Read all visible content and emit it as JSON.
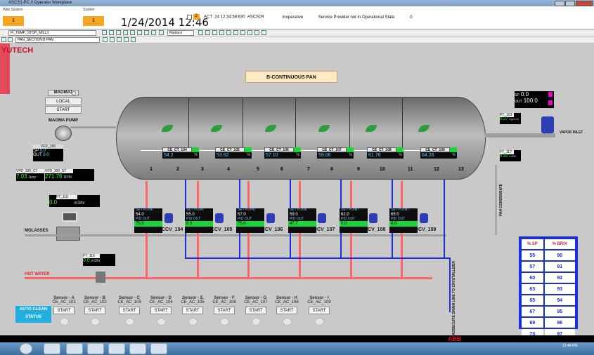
{
  "window": {
    "title": "ASCS1-PC // Operator Workplace"
  },
  "header": {
    "web_system_label": "Web System",
    "web_system_count": "1",
    "system_label": "System",
    "system_count": "1",
    "datetime": "1/24/2014 12:46",
    "alarm": {
      "count": "2",
      "state": "ACT",
      "time": "24 12:34:58:630",
      "source": "ASCS1R",
      "status": "Inoperative",
      "message": "Service Provider not in Operational State",
      "value": "0"
    }
  },
  "toolbar": {
    "object_combo": "FI_TEMP_STOP_MILL3",
    "replace_label": "Replace",
    "section_combo": "PAN_SECTION:B PAN"
  },
  "brand": "YUTECH",
  "title": "B-CONTINUOUS PAN",
  "magma": {
    "name": "MAGMA1",
    "local": "LOCAL",
    "start": "START",
    "pump_label": "MAGMA PUMP"
  },
  "vfd100": {
    "tag": "VFD_100",
    "sp_label": "SP",
    "sp": "0.0",
    "out_label": "OUT",
    "out": "0.0"
  },
  "vfd_ct": {
    "tag": "VFD_100_CT",
    "value": "7.03",
    "unit": "Amp"
  },
  "vfd_st": {
    "tag": "VFD_100_ST",
    "value": "271.76",
    "unit": "RPM"
  },
  "ft115": {
    "tag": "FT_115",
    "value": "0.0",
    "unit": "m3/hr"
  },
  "ft116": {
    "tag": "FT_116",
    "value": "0.0",
    "unit": "m3/hr"
  },
  "ft101": {
    "tag": "PT_101",
    "value": "0.27",
    "unit": "Kg/cm2"
  },
  "ft117": {
    "tag": "FT_117",
    "value": "0.22",
    "unit": "m3/hr"
  },
  "vapor": {
    "sp_label": "SP",
    "sp": "0.0",
    "out_label": "OUT",
    "out": "100.0",
    "label": "VAPOR INLET"
  },
  "labels": {
    "molasses": "MOLASSES",
    "hot_water": "HOT WATER",
    "pan_condensate": "PAN CONDENSATE",
    "massecuite": "MASSECUITE DRAIN LINE TO CRYSTALLIZER"
  },
  "compartments": [
    "1",
    "2",
    "3",
    "4",
    "5",
    "6",
    "7",
    "8",
    "9",
    "10",
    "11",
    "12",
    "13"
  ],
  "current_tags": [
    {
      "tag": "CE_CT_104",
      "value": "54.2",
      "unit": "%"
    },
    {
      "tag": "CE_CT_105",
      "value": "53.62",
      "unit": "%"
    },
    {
      "tag": "CE_CT_106",
      "value": "57.10",
      "unit": "%"
    },
    {
      "tag": "CE_CT_107",
      "value": "59.06",
      "unit": "%"
    },
    {
      "tag": "CE_CT_108",
      "value": "61.76",
      "unit": "%"
    },
    {
      "tag": "CE_CT_109",
      "value": "64.26",
      "unit": "%"
    }
  ],
  "pid_labels": {
    "set_point": "SET POINT",
    "pid_out": "PID OUT"
  },
  "pids": [
    {
      "sp": "54.0",
      "out": "75.0",
      "valve": "CCV_104"
    },
    {
      "sp": "55.0",
      "out": "0.0",
      "valve": "CCV_105"
    },
    {
      "sp": "57.0",
      "out": "75.0",
      "valve": "CCV_106"
    },
    {
      "sp": "59.0",
      "out": "47.7",
      "valve": "CCV_107"
    },
    {
      "sp": "62.0",
      "out": "0.0",
      "valve": "CCV_108"
    },
    {
      "sp": "65.0",
      "out": "0.0",
      "valve": "CCV_109"
    }
  ],
  "auto_clean": "AUTO CLEAN STATUS",
  "sensors": [
    {
      "name": "Sensor - A",
      "tag": "CE_AC_101",
      "button": "START"
    },
    {
      "name": "Sensor - B",
      "tag": "CE_AC_102",
      "button": "START"
    },
    {
      "name": "Sensor - C",
      "tag": "CE_AC_103",
      "button": "START"
    },
    {
      "name": "Sensor - D",
      "tag": "CE_AC_104",
      "button": "START"
    },
    {
      "name": "Sensor - E",
      "tag": "CE_AC_105",
      "button": "START"
    },
    {
      "name": "Sensor - F",
      "tag": "CE_AC_106",
      "button": "START"
    },
    {
      "name": "Sensor - G",
      "tag": "CE_AC_107",
      "button": "START"
    },
    {
      "name": "Sensor - H",
      "tag": "CE_AC_108",
      "button": "START"
    },
    {
      "name": "Sensor - I",
      "tag": "CE_AC_109",
      "button": "START"
    }
  ],
  "brix_table": {
    "headers": [
      "% SP",
      "% BRIX"
    ],
    "rows": [
      [
        "55",
        "90"
      ],
      [
        "57",
        "91"
      ],
      [
        "60",
        "92"
      ],
      [
        "63",
        "93"
      ],
      [
        "65",
        "94"
      ],
      [
        "67",
        "95"
      ],
      [
        "69",
        "96"
      ],
      [
        "73",
        "97"
      ]
    ]
  },
  "footer": {
    "brand": "ABB",
    "clock": "12:46 PM"
  },
  "colors": {
    "accent_orange": "#f5a623",
    "pipe_red": "#ff6666",
    "pipe_blue": "#1a2ee0",
    "status_green": "#19d43b",
    "brand_red": "#c8102e"
  }
}
